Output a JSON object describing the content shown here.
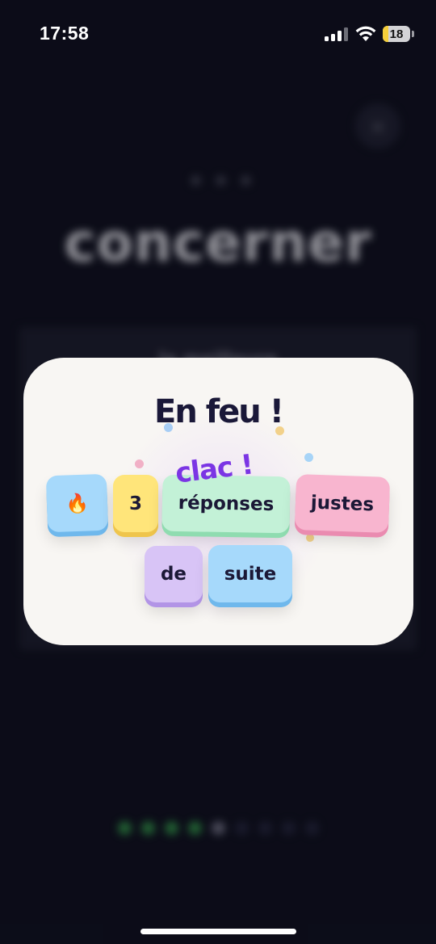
{
  "status_bar": {
    "time": "17:58",
    "battery_level": "18"
  },
  "background": {
    "word": "concerner",
    "panel_text": "la meilleure",
    "close_icon": "close-icon",
    "progress": {
      "total": 9,
      "done": 4,
      "current_index": 4
    }
  },
  "modal": {
    "title": "En feu !",
    "sticker": "clac !",
    "tiles": {
      "fire": "🔥",
      "count": "3",
      "reponses": "réponses",
      "justes": "justes",
      "de": "de",
      "suite": "suite"
    }
  },
  "colors": {
    "accent_purple": "#7b35e4",
    "title": "#1a1838",
    "tile_blue": "#a6d9fb",
    "tile_yellow": "#ffe57a",
    "tile_green": "#c3f1d7",
    "tile_pink": "#f8b5cf",
    "tile_purple": "#d8c4f6",
    "progress_done": "#2f8d44"
  }
}
